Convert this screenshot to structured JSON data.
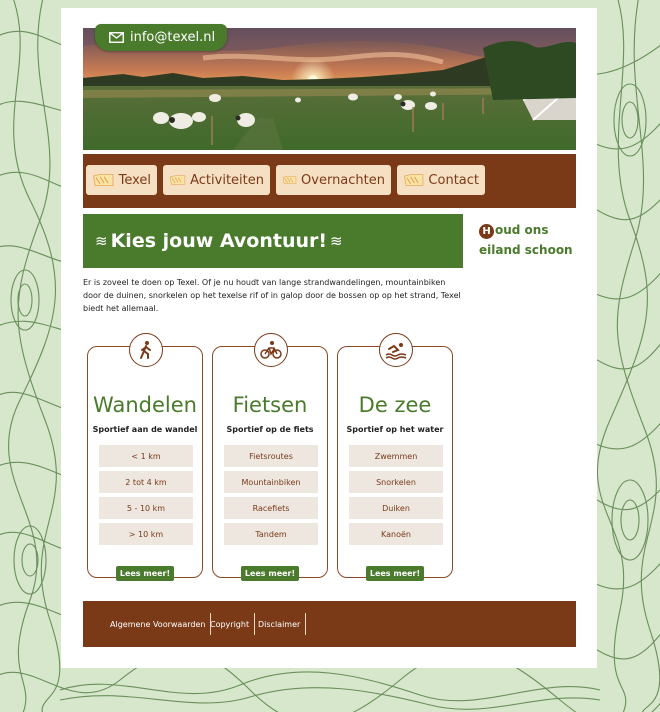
{
  "contact": {
    "email": "info@texel.nl"
  },
  "nav": {
    "items": [
      {
        "label": "Texel"
      },
      {
        "label": "Activiteiten"
      },
      {
        "label": "Overnachten"
      },
      {
        "label": "Contact"
      }
    ]
  },
  "banner": {
    "title": "Kies jouw Avontuur!",
    "waves": "≋"
  },
  "side_note": {
    "initial": "H",
    "text": "oud ons eiland schoon"
  },
  "intro": {
    "text": "Er is zoveel te doen op Texel. Of je nu houdt van lange strandwandelingen, mountainbiken door de duinen, snorkelen op het texelse rif of in galop door de bossen op op het strand, Texel biedt het allemaal."
  },
  "cards": [
    {
      "title": "Wandelen",
      "subtitle": "Sportief aan de wandel",
      "icon": "hiker-icon",
      "items": [
        "< 1 km",
        "2 tot 4 km",
        "5 - 10 km",
        "> 10 km"
      ],
      "button": "Lees meer!"
    },
    {
      "title": "Fietsen",
      "subtitle": "Sportief op de fiets",
      "icon": "cyclist-icon",
      "items": [
        "Fietsroutes",
        "Mountainbiken",
        "Racefiets",
        "Tandem"
      ],
      "button": "Lees meer!"
    },
    {
      "title": "De zee",
      "subtitle": "Sportief op het water",
      "icon": "swimmer-icon",
      "items": [
        "Zwemmen",
        "Snorkelen",
        "Duiken",
        "Kanoën"
      ],
      "button": "Lees meer!"
    }
  ],
  "footer": {
    "links": [
      {
        "label": "Algemene Voorwaarden"
      },
      {
        "label": "Copyright"
      },
      {
        "label": "Disclaimer"
      }
    ]
  },
  "colors": {
    "green": "#4a7a2b",
    "brown": "#7a3a18",
    "cream": "#f6e0c3",
    "background": "#d6e7cc"
  }
}
